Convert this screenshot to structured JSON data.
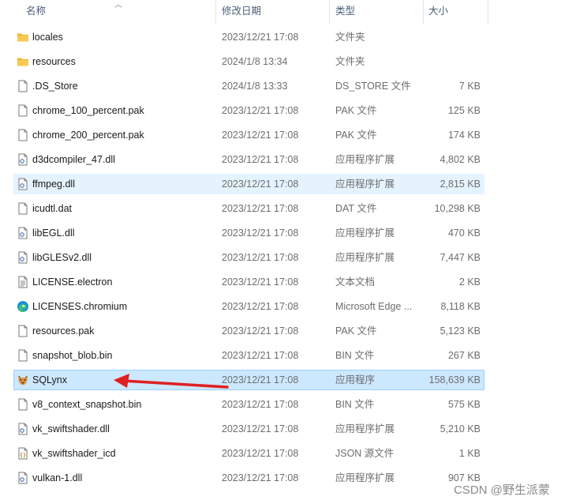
{
  "header": {
    "name": "名称",
    "date": "修改日期",
    "type": "类型",
    "size": "大小"
  },
  "files": [
    {
      "name": "locales",
      "date": "2023/12/21 17:08",
      "type": "文件夹",
      "size": "",
      "icon": "folder-icon"
    },
    {
      "name": "resources",
      "date": "2024/1/8 13:34",
      "type": "文件夹",
      "size": "",
      "icon": "folder-icon"
    },
    {
      "name": ".DS_Store",
      "date": "2024/1/8 13:33",
      "type": "DS_STORE 文件",
      "size": "7 KB",
      "icon": "file-icon"
    },
    {
      "name": "chrome_100_percent.pak",
      "date": "2023/12/21 17:08",
      "type": "PAK 文件",
      "size": "125 KB",
      "icon": "file-icon"
    },
    {
      "name": "chrome_200_percent.pak",
      "date": "2023/12/21 17:08",
      "type": "PAK 文件",
      "size": "174 KB",
      "icon": "file-icon"
    },
    {
      "name": "d3dcompiler_47.dll",
      "date": "2023/12/21 17:08",
      "type": "应用程序扩展",
      "size": "4,802 KB",
      "icon": "dll-icon"
    },
    {
      "name": "ffmpeg.dll",
      "date": "2023/12/21 17:08",
      "type": "应用程序扩展",
      "size": "2,815 KB",
      "icon": "dll-icon"
    },
    {
      "name": "icudtl.dat",
      "date": "2023/12/21 17:08",
      "type": "DAT 文件",
      "size": "10,298 KB",
      "icon": "file-icon"
    },
    {
      "name": "libEGL.dll",
      "date": "2023/12/21 17:08",
      "type": "应用程序扩展",
      "size": "470 KB",
      "icon": "dll-icon"
    },
    {
      "name": "libGLESv2.dll",
      "date": "2023/12/21 17:08",
      "type": "应用程序扩展",
      "size": "7,447 KB",
      "icon": "dll-icon"
    },
    {
      "name": "LICENSE.electron",
      "date": "2023/12/21 17:08",
      "type": "文本文档",
      "size": "2 KB",
      "icon": "text-file-icon"
    },
    {
      "name": "LICENSES.chromium",
      "date": "2023/12/21 17:08",
      "type": "Microsoft Edge ...",
      "size": "8,118 KB",
      "icon": "edge-icon"
    },
    {
      "name": "resources.pak",
      "date": "2023/12/21 17:08",
      "type": "PAK 文件",
      "size": "5,123 KB",
      "icon": "file-icon"
    },
    {
      "name": "snapshot_blob.bin",
      "date": "2023/12/21 17:08",
      "type": "BIN 文件",
      "size": "267 KB",
      "icon": "file-icon"
    },
    {
      "name": "SQLynx",
      "date": "2023/12/21 17:08",
      "type": "应用程序",
      "size": "158,639 KB",
      "icon": "sqlynx-app-icon"
    },
    {
      "name": "v8_context_snapshot.bin",
      "date": "2023/12/21 17:08",
      "type": "BIN 文件",
      "size": "575 KB",
      "icon": "file-icon"
    },
    {
      "name": "vk_swiftshader.dll",
      "date": "2023/12/21 17:08",
      "type": "应用程序扩展",
      "size": "5,210 KB",
      "icon": "dll-icon"
    },
    {
      "name": "vk_swiftshader_icd",
      "date": "2023/12/21 17:08",
      "type": "JSON 源文件",
      "size": "1 KB",
      "icon": "json-file-icon"
    },
    {
      "name": "vulkan-1.dll",
      "date": "2023/12/21 17:08",
      "type": "应用程序扩展",
      "size": "907 KB",
      "icon": "dll-icon"
    }
  ],
  "hover_row": "ffmpeg.dll",
  "selected_row": "SQLynx",
  "watermark": "CSDN @野生派蒙",
  "colors": {
    "selected_bg": "#cce8ff",
    "hover_bg": "#e5f3ff",
    "folder": "#f8c954",
    "arrow": "#e02020"
  }
}
